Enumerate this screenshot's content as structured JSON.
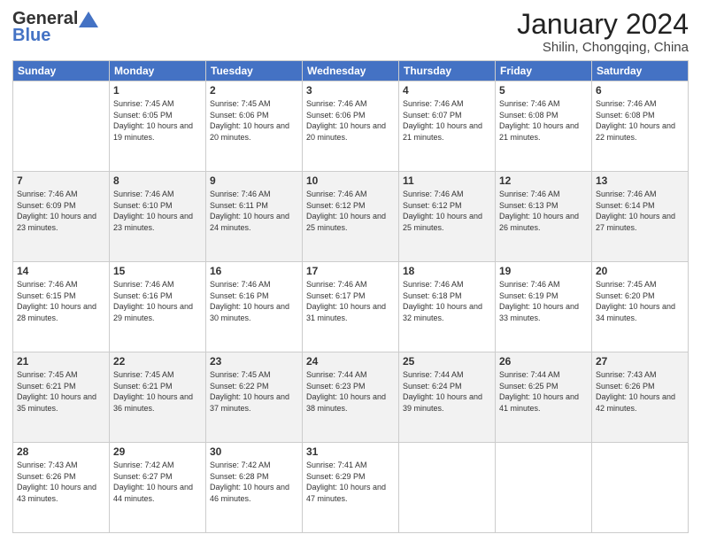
{
  "header": {
    "logo_general": "General",
    "logo_blue": "Blue",
    "month_title": "January 2024",
    "subtitle": "Shilin, Chongqing, China"
  },
  "weekdays": [
    "Sunday",
    "Monday",
    "Tuesday",
    "Wednesday",
    "Thursday",
    "Friday",
    "Saturday"
  ],
  "weeks": [
    [
      {
        "day": "",
        "sunrise": "",
        "sunset": "",
        "daylight": ""
      },
      {
        "day": "1",
        "sunrise": "Sunrise: 7:45 AM",
        "sunset": "Sunset: 6:05 PM",
        "daylight": "Daylight: 10 hours and 19 minutes."
      },
      {
        "day": "2",
        "sunrise": "Sunrise: 7:45 AM",
        "sunset": "Sunset: 6:06 PM",
        "daylight": "Daylight: 10 hours and 20 minutes."
      },
      {
        "day": "3",
        "sunrise": "Sunrise: 7:46 AM",
        "sunset": "Sunset: 6:06 PM",
        "daylight": "Daylight: 10 hours and 20 minutes."
      },
      {
        "day": "4",
        "sunrise": "Sunrise: 7:46 AM",
        "sunset": "Sunset: 6:07 PM",
        "daylight": "Daylight: 10 hours and 21 minutes."
      },
      {
        "day": "5",
        "sunrise": "Sunrise: 7:46 AM",
        "sunset": "Sunset: 6:08 PM",
        "daylight": "Daylight: 10 hours and 21 minutes."
      },
      {
        "day": "6",
        "sunrise": "Sunrise: 7:46 AM",
        "sunset": "Sunset: 6:08 PM",
        "daylight": "Daylight: 10 hours and 22 minutes."
      }
    ],
    [
      {
        "day": "7",
        "sunrise": "Sunrise: 7:46 AM",
        "sunset": "Sunset: 6:09 PM",
        "daylight": "Daylight: 10 hours and 23 minutes."
      },
      {
        "day": "8",
        "sunrise": "Sunrise: 7:46 AM",
        "sunset": "Sunset: 6:10 PM",
        "daylight": "Daylight: 10 hours and 23 minutes."
      },
      {
        "day": "9",
        "sunrise": "Sunrise: 7:46 AM",
        "sunset": "Sunset: 6:11 PM",
        "daylight": "Daylight: 10 hours and 24 minutes."
      },
      {
        "day": "10",
        "sunrise": "Sunrise: 7:46 AM",
        "sunset": "Sunset: 6:12 PM",
        "daylight": "Daylight: 10 hours and 25 minutes."
      },
      {
        "day": "11",
        "sunrise": "Sunrise: 7:46 AM",
        "sunset": "Sunset: 6:12 PM",
        "daylight": "Daylight: 10 hours and 25 minutes."
      },
      {
        "day": "12",
        "sunrise": "Sunrise: 7:46 AM",
        "sunset": "Sunset: 6:13 PM",
        "daylight": "Daylight: 10 hours and 26 minutes."
      },
      {
        "day": "13",
        "sunrise": "Sunrise: 7:46 AM",
        "sunset": "Sunset: 6:14 PM",
        "daylight": "Daylight: 10 hours and 27 minutes."
      }
    ],
    [
      {
        "day": "14",
        "sunrise": "Sunrise: 7:46 AM",
        "sunset": "Sunset: 6:15 PM",
        "daylight": "Daylight: 10 hours and 28 minutes."
      },
      {
        "day": "15",
        "sunrise": "Sunrise: 7:46 AM",
        "sunset": "Sunset: 6:16 PM",
        "daylight": "Daylight: 10 hours and 29 minutes."
      },
      {
        "day": "16",
        "sunrise": "Sunrise: 7:46 AM",
        "sunset": "Sunset: 6:16 PM",
        "daylight": "Daylight: 10 hours and 30 minutes."
      },
      {
        "day": "17",
        "sunrise": "Sunrise: 7:46 AM",
        "sunset": "Sunset: 6:17 PM",
        "daylight": "Daylight: 10 hours and 31 minutes."
      },
      {
        "day": "18",
        "sunrise": "Sunrise: 7:46 AM",
        "sunset": "Sunset: 6:18 PM",
        "daylight": "Daylight: 10 hours and 32 minutes."
      },
      {
        "day": "19",
        "sunrise": "Sunrise: 7:46 AM",
        "sunset": "Sunset: 6:19 PM",
        "daylight": "Daylight: 10 hours and 33 minutes."
      },
      {
        "day": "20",
        "sunrise": "Sunrise: 7:45 AM",
        "sunset": "Sunset: 6:20 PM",
        "daylight": "Daylight: 10 hours and 34 minutes."
      }
    ],
    [
      {
        "day": "21",
        "sunrise": "Sunrise: 7:45 AM",
        "sunset": "Sunset: 6:21 PM",
        "daylight": "Daylight: 10 hours and 35 minutes."
      },
      {
        "day": "22",
        "sunrise": "Sunrise: 7:45 AM",
        "sunset": "Sunset: 6:21 PM",
        "daylight": "Daylight: 10 hours and 36 minutes."
      },
      {
        "day": "23",
        "sunrise": "Sunrise: 7:45 AM",
        "sunset": "Sunset: 6:22 PM",
        "daylight": "Daylight: 10 hours and 37 minutes."
      },
      {
        "day": "24",
        "sunrise": "Sunrise: 7:44 AM",
        "sunset": "Sunset: 6:23 PM",
        "daylight": "Daylight: 10 hours and 38 minutes."
      },
      {
        "day": "25",
        "sunrise": "Sunrise: 7:44 AM",
        "sunset": "Sunset: 6:24 PM",
        "daylight": "Daylight: 10 hours and 39 minutes."
      },
      {
        "day": "26",
        "sunrise": "Sunrise: 7:44 AM",
        "sunset": "Sunset: 6:25 PM",
        "daylight": "Daylight: 10 hours and 41 minutes."
      },
      {
        "day": "27",
        "sunrise": "Sunrise: 7:43 AM",
        "sunset": "Sunset: 6:26 PM",
        "daylight": "Daylight: 10 hours and 42 minutes."
      }
    ],
    [
      {
        "day": "28",
        "sunrise": "Sunrise: 7:43 AM",
        "sunset": "Sunset: 6:26 PM",
        "daylight": "Daylight: 10 hours and 43 minutes."
      },
      {
        "day": "29",
        "sunrise": "Sunrise: 7:42 AM",
        "sunset": "Sunset: 6:27 PM",
        "daylight": "Daylight: 10 hours and 44 minutes."
      },
      {
        "day": "30",
        "sunrise": "Sunrise: 7:42 AM",
        "sunset": "Sunset: 6:28 PM",
        "daylight": "Daylight: 10 hours and 46 minutes."
      },
      {
        "day": "31",
        "sunrise": "Sunrise: 7:41 AM",
        "sunset": "Sunset: 6:29 PM",
        "daylight": "Daylight: 10 hours and 47 minutes."
      },
      {
        "day": "",
        "sunrise": "",
        "sunset": "",
        "daylight": ""
      },
      {
        "day": "",
        "sunrise": "",
        "sunset": "",
        "daylight": ""
      },
      {
        "day": "",
        "sunrise": "",
        "sunset": "",
        "daylight": ""
      }
    ]
  ]
}
